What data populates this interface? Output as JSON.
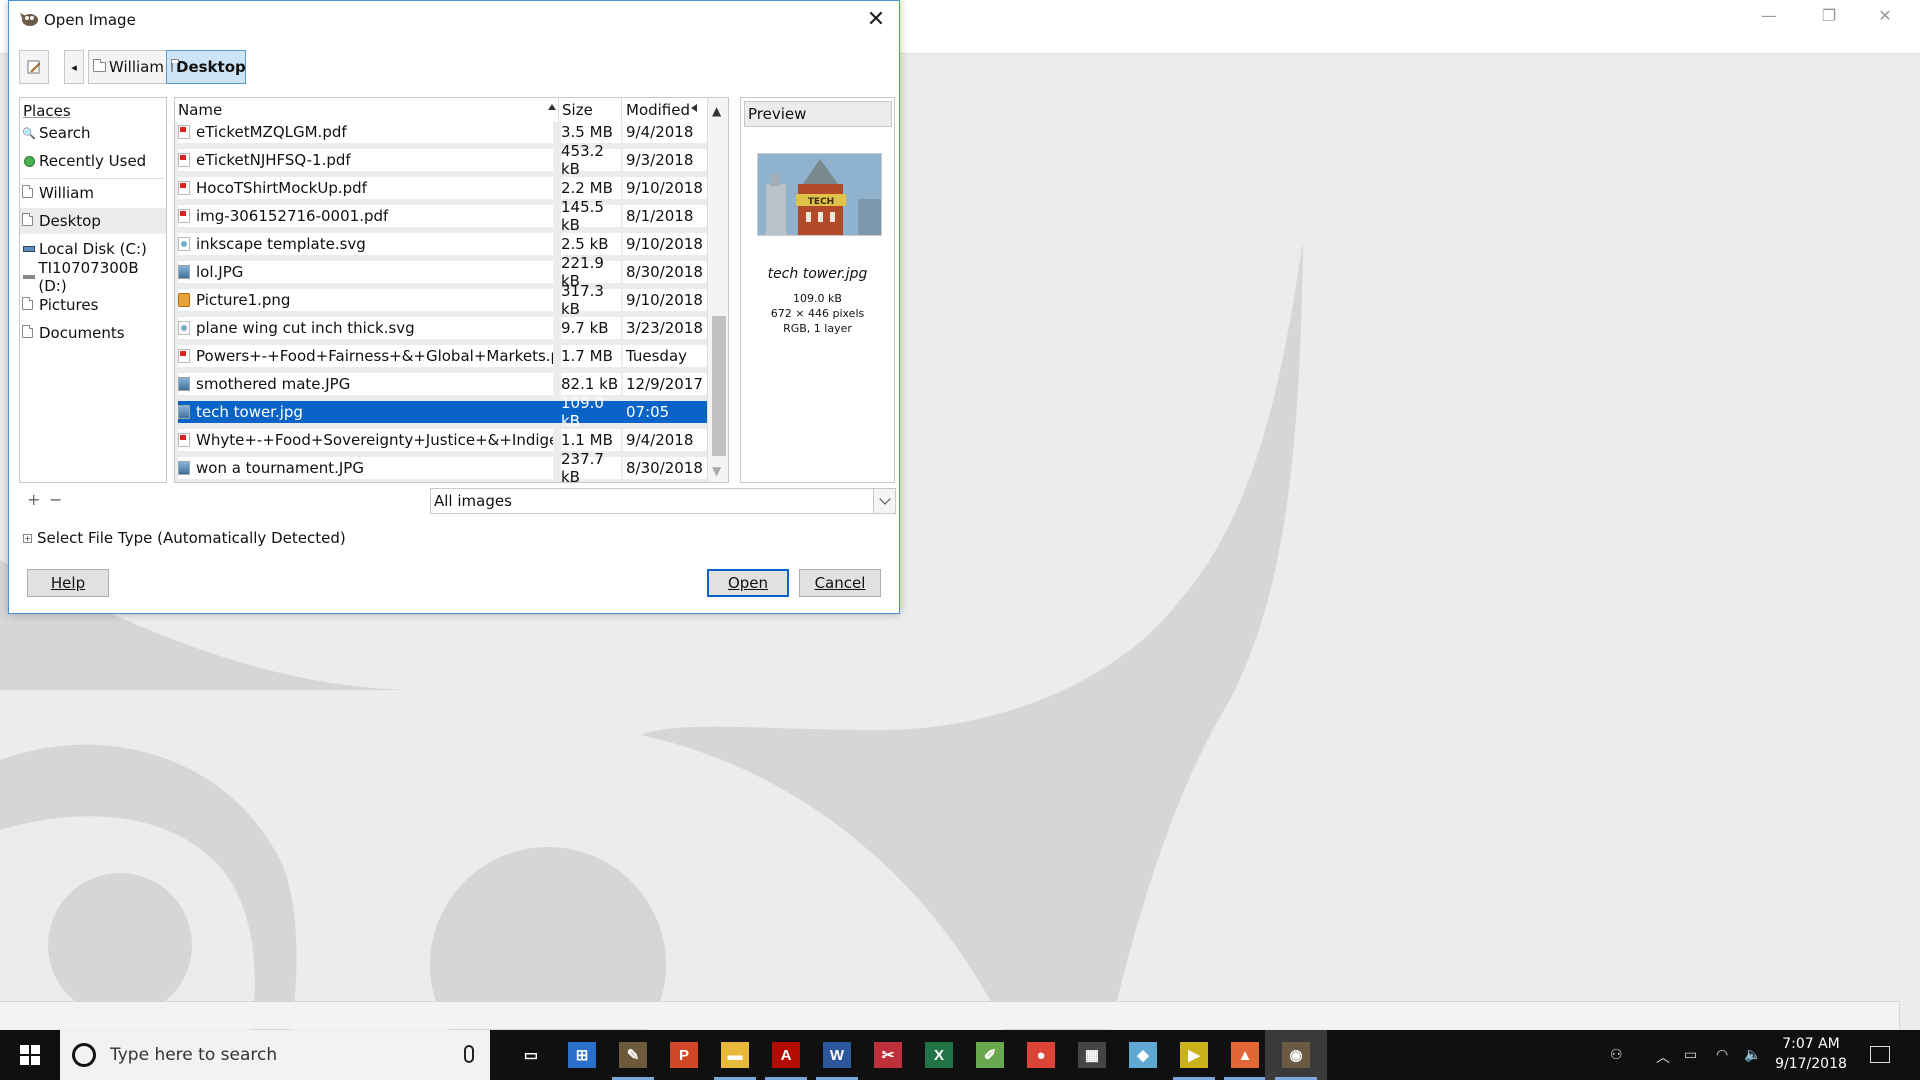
{
  "dialog": {
    "title": "Open Image",
    "close_label": "✕"
  },
  "pathbar": {
    "back_glyph": "◂",
    "crumbs": [
      "William",
      "Desktop"
    ]
  },
  "places": {
    "header": "Places",
    "items": [
      {
        "label": "Search",
        "icon": "search-icon"
      },
      {
        "label": "Recently Used",
        "icon": "recent-icon"
      },
      {
        "label": "William",
        "icon": "folder-icon"
      },
      {
        "label": "Desktop",
        "icon": "folder-icon"
      },
      {
        "label": "Local Disk (C:)",
        "icon": "drive-icon"
      },
      {
        "label": "TI10707300B (D:)",
        "icon": "drive-icon"
      },
      {
        "label": "Pictures",
        "icon": "folder-icon"
      },
      {
        "label": "Documents",
        "icon": "folder-icon"
      }
    ],
    "add_glyph": "+",
    "remove_glyph": "−"
  },
  "filelist": {
    "columns": {
      "name": "Name",
      "size": "Size",
      "modified": "Modified"
    },
    "rows": [
      {
        "name": "eTicketMZQLGM.pdf",
        "size": "3.5 MB",
        "modified": "9/4/2018",
        "type": "pdf"
      },
      {
        "name": "eTicketNJHFSQ-1.pdf",
        "size": "453.2 kB",
        "modified": "9/3/2018",
        "type": "pdf"
      },
      {
        "name": "HocoTShirtMockUp.pdf",
        "size": "2.2 MB",
        "modified": "9/10/2018",
        "type": "pdf"
      },
      {
        "name": "img-306152716-0001.pdf",
        "size": "145.5 kB",
        "modified": "8/1/2018",
        "type": "pdf"
      },
      {
        "name": "inkscape template.svg",
        "size": "2.5 kB",
        "modified": "9/10/2018",
        "type": "svg"
      },
      {
        "name": "lol.JPG",
        "size": "221.9 kB",
        "modified": "8/30/2018",
        "type": "img"
      },
      {
        "name": "Picture1.png",
        "size": "317.3 kB",
        "modified": "9/10/2018",
        "type": "png"
      },
      {
        "name": "plane wing cut inch thick.svg",
        "size": "9.7 kB",
        "modified": "3/23/2018",
        "type": "svg"
      },
      {
        "name": "Powers+-+Food+Fairness+&+Global+Markets.pdf",
        "size": "1.7 MB",
        "modified": "Tuesday",
        "type": "pdf"
      },
      {
        "name": "smothered mate.JPG",
        "size": "82.1 kB",
        "modified": "12/9/2017",
        "type": "img"
      },
      {
        "name": "tech tower.jpg",
        "size": "109.0 kB",
        "modified": "07:05",
        "type": "img",
        "selected": true
      },
      {
        "name": "Whyte+-+Food+Sovereignty+Justice+&+Indigenou...",
        "size": "1.1 MB",
        "modified": "9/4/2018",
        "type": "pdf"
      },
      {
        "name": "won a tournament.JPG",
        "size": "237.7 kB",
        "modified": "8/30/2018",
        "type": "img"
      }
    ]
  },
  "preview": {
    "header": "Preview",
    "filename": "tech tower.jpg",
    "thumb_text": "TECH",
    "size": "109.0 kB",
    "dimensions": "672 × 446 pixels",
    "mode": "RGB, 1 layer"
  },
  "filter": {
    "selected": "All images"
  },
  "filetype": {
    "expander_glyph": "+",
    "label": "Select File Type (Automatically Detected)"
  },
  "buttons": {
    "help": "Help",
    "open": "Open",
    "cancel": "Cancel"
  },
  "taskbar": {
    "search_placeholder": "Type here to search",
    "apps": [
      {
        "name": "task-view-icon",
        "glyph": "▭",
        "color": "#101010"
      },
      {
        "name": "network-app-icon",
        "glyph": "⊞",
        "color": "#2a6fc9"
      },
      {
        "name": "paint-app-icon",
        "glyph": "✎",
        "color": "#6c5a3a"
      },
      {
        "name": "powerpoint-icon",
        "glyph": "P",
        "color": "#d24726"
      },
      {
        "name": "file-explorer-icon",
        "glyph": "▬",
        "color": "#e8b83a"
      },
      {
        "name": "acrobat-icon",
        "glyph": "A",
        "color": "#b30b00"
      },
      {
        "name": "word-icon",
        "glyph": "W",
        "color": "#2b579a"
      },
      {
        "name": "snipping-icon",
        "glyph": "✂",
        "color": "#c0303a"
      },
      {
        "name": "excel-icon",
        "glyph": "X",
        "color": "#217346"
      },
      {
        "name": "paint-icon",
        "glyph": "✐",
        "color": "#6aa84f"
      },
      {
        "name": "chrome-icon",
        "glyph": "●",
        "color": "#db4437"
      },
      {
        "name": "calculator-icon",
        "glyph": "▦",
        "color": "#444444"
      },
      {
        "name": "notes-app-icon",
        "glyph": "◆",
        "color": "#5fa8d3"
      },
      {
        "name": "labview-icon",
        "glyph": "▶",
        "color": "#c9b21a"
      },
      {
        "name": "matlab-icon",
        "glyph": "▲",
        "color": "#e16737"
      },
      {
        "name": "gimp-icon",
        "glyph": "◉",
        "color": "#6b5b45"
      }
    ],
    "clock_time": "7:07 AM",
    "clock_date": "9/17/2018"
  },
  "colors": {
    "selection": "#0a64c8",
    "accent": "#4a90d9"
  }
}
